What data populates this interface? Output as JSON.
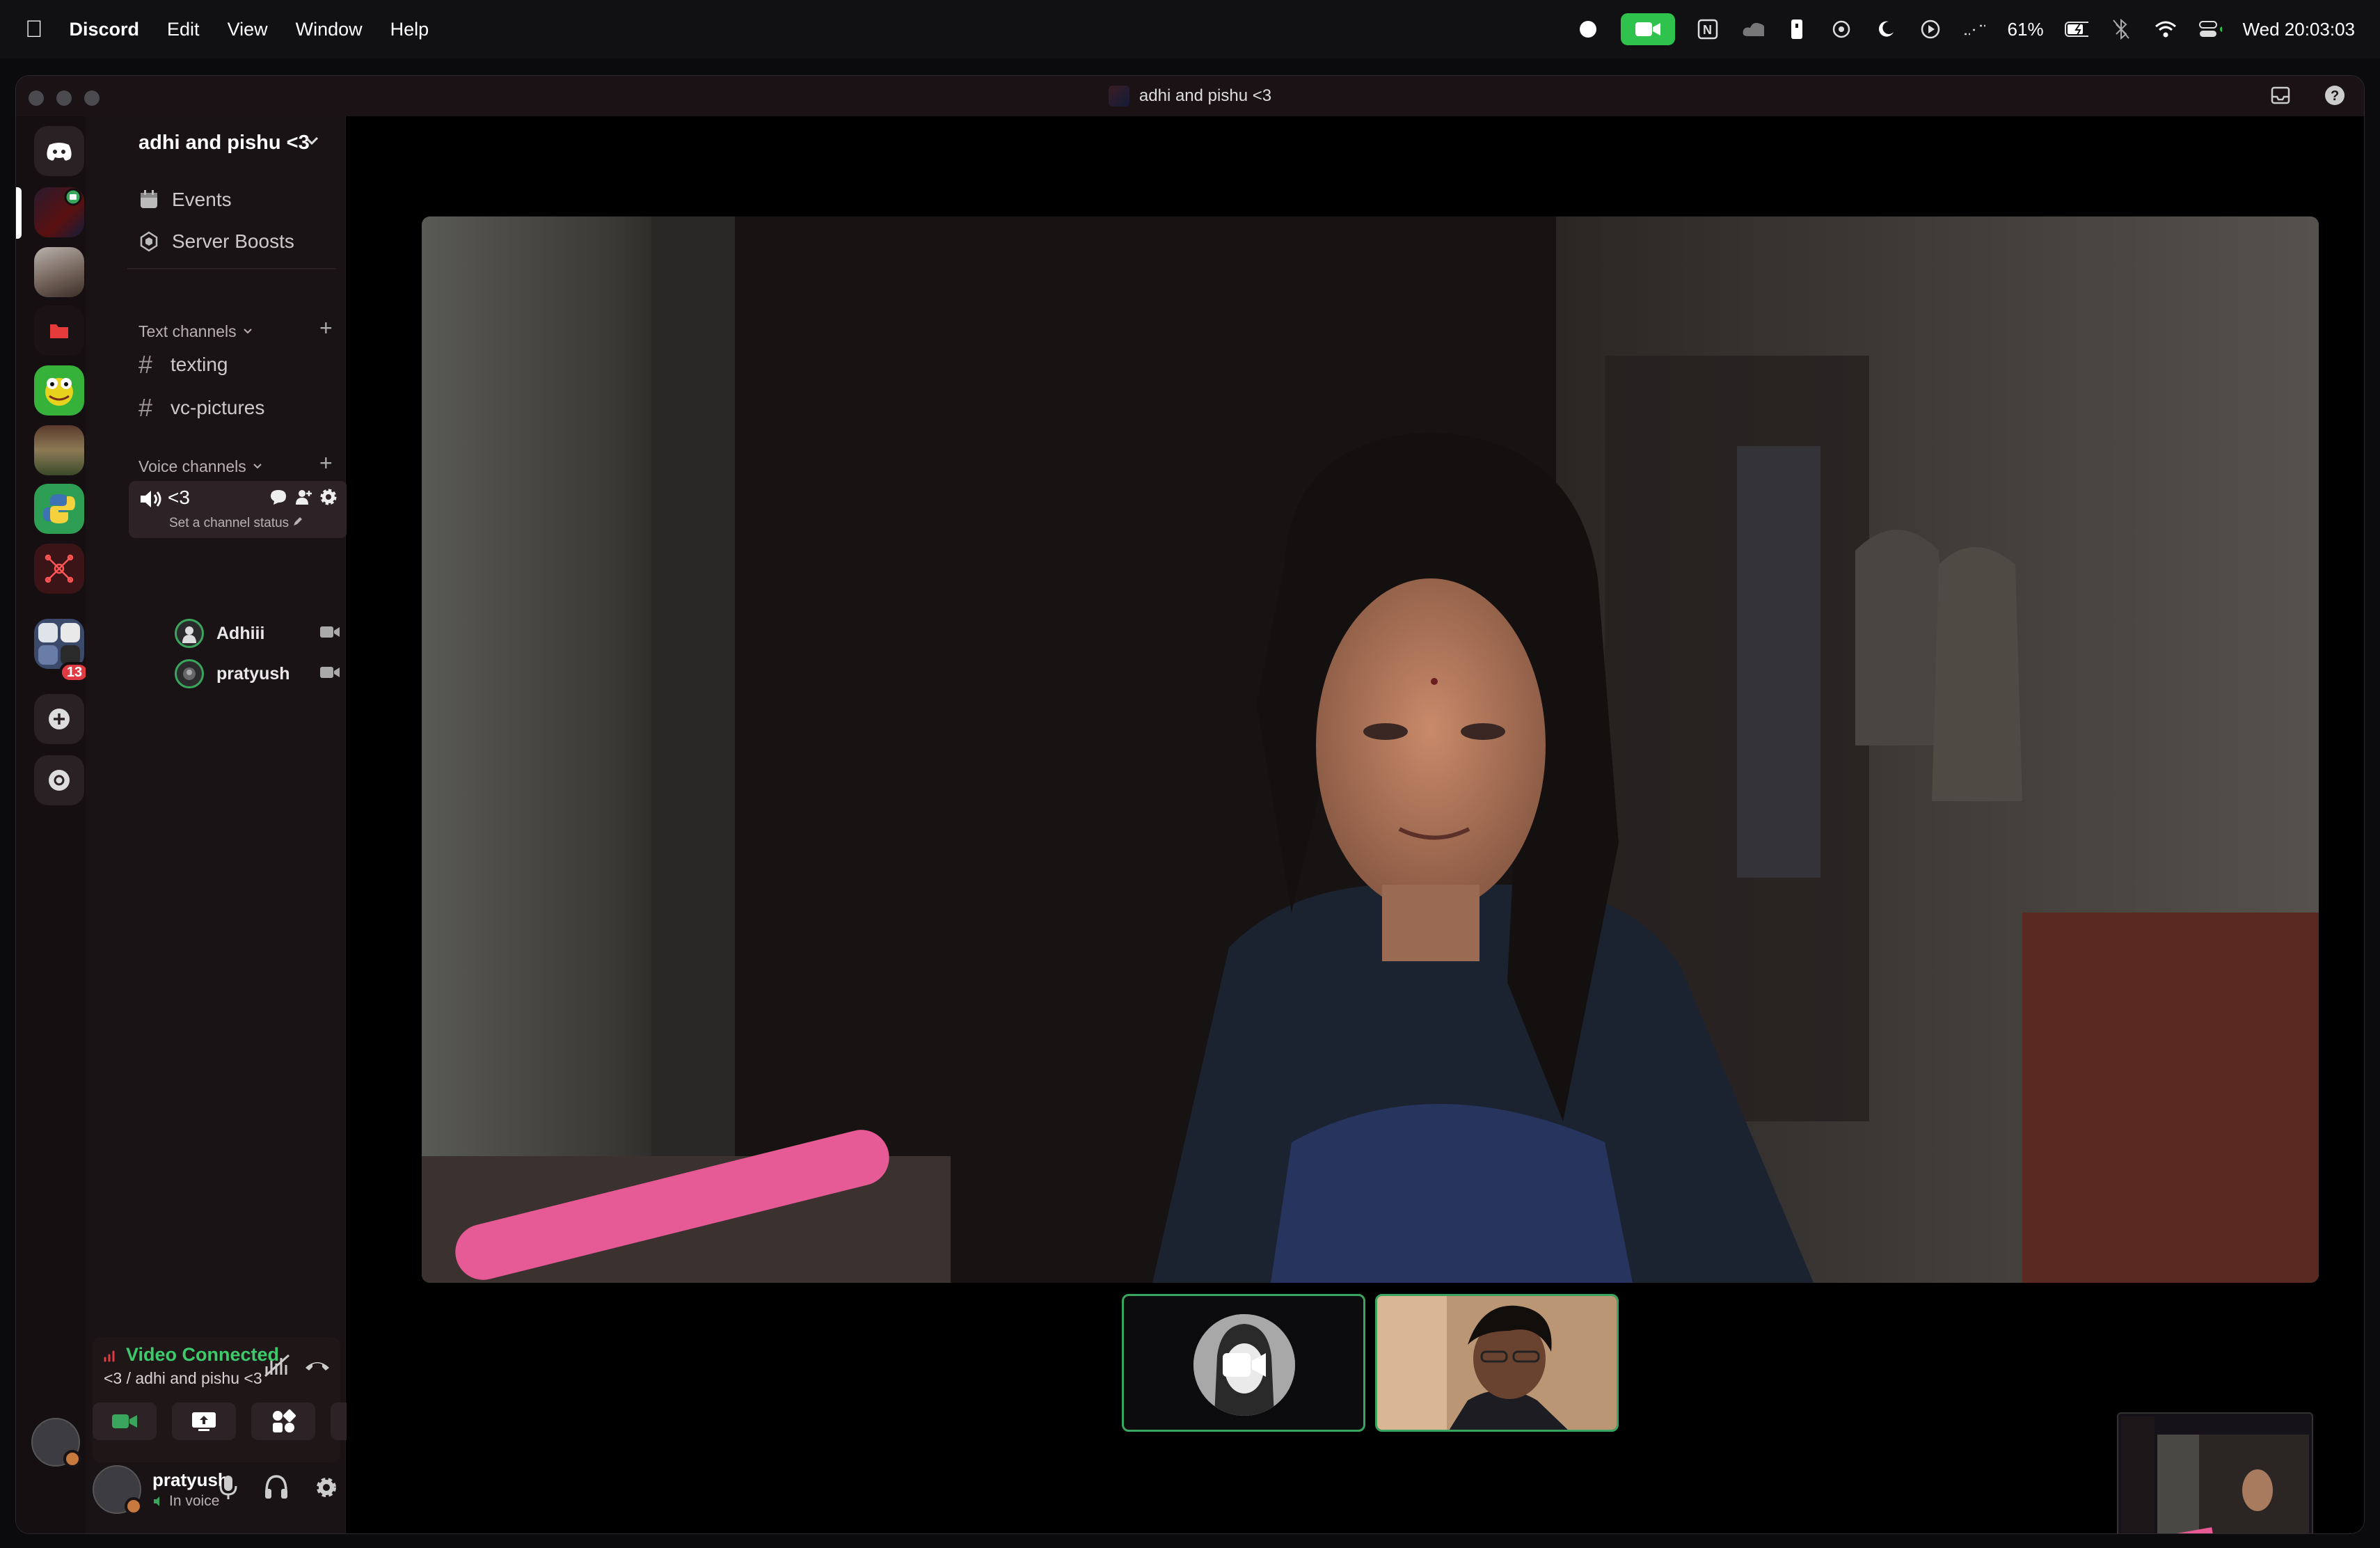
{
  "menubar": {
    "app_name": "Discord",
    "items": [
      "Edit",
      "View",
      "Window",
      "Help"
    ],
    "battery": "61%",
    "clock": "Wed 20:03:03"
  },
  "window": {
    "title": "adhi and pishu <3"
  },
  "sidebar": {
    "server_name": "adhi and pishu <3",
    "menu": [
      {
        "label": "Events",
        "icon": "calendar-icon"
      },
      {
        "label": "Server Boosts",
        "icon": "boost-icon"
      }
    ],
    "text_category": "Text channels",
    "text_channels": [
      "texting",
      "vc-pictures"
    ],
    "voice_category": "Voice channels",
    "voice_channel": {
      "name": "<3",
      "status": "Set a channel status",
      "members": [
        "Adhiii",
        "pratyush"
      ]
    }
  },
  "rail": {
    "badge_count": "13"
  },
  "voice_panel": {
    "title": "Video Connected",
    "subtitle": "<3 / adhi and pishu <3"
  },
  "user": {
    "name": "pratyush",
    "status": "In voice"
  },
  "colors": {
    "accent_green": "#3aa55d",
    "badge_red": "#e03b42",
    "facetime_green": "#2fc24d"
  }
}
